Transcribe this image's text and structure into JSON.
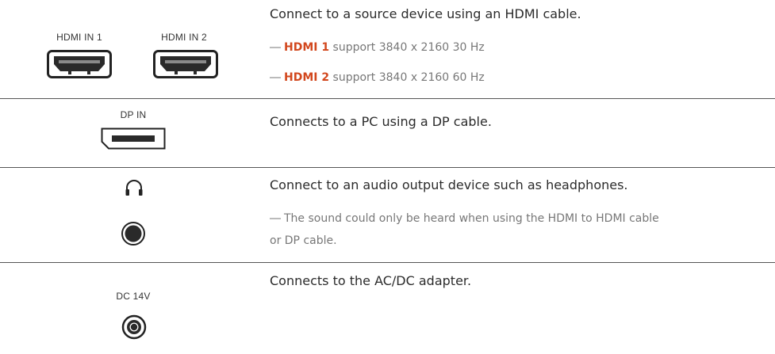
{
  "rows": [
    {
      "ports": [
        "HDMI IN 1",
        "HDMI IN 2"
      ],
      "description": "Connect to a source device using an HDMI cable.",
      "notes": [
        {
          "highlight": "HDMI 1",
          "text": " support 3840 x 2160 30 Hz"
        },
        {
          "highlight": "HDMI 2",
          "text": " support 3840 x 2160 60 Hz"
        }
      ],
      "icons": [
        "hdmi-port-icon",
        "hdmi-port-icon"
      ]
    },
    {
      "ports": [
        "DP IN"
      ],
      "description": "Connects to a PC using a DP cable.",
      "icons": [
        "displayport-icon"
      ]
    },
    {
      "ports": [],
      "description": "Connect to an audio output device such as headphones.",
      "notes": [
        {
          "line1": "The sound could only be heard when using the HDMI to HDMI cable",
          "line2": "or DP cable."
        }
      ],
      "icons": [
        "headphones-icon",
        "audio-jack-icon"
      ]
    },
    {
      "ports": [
        "DC 14V"
      ],
      "description": "Connects to the AC/DC adapter.",
      "icons": [
        "dc-power-jack-icon"
      ]
    }
  ],
  "colors": {
    "highlight": "#d2471d",
    "note": "#777777",
    "divider": "#555555"
  },
  "note_mark": "―"
}
